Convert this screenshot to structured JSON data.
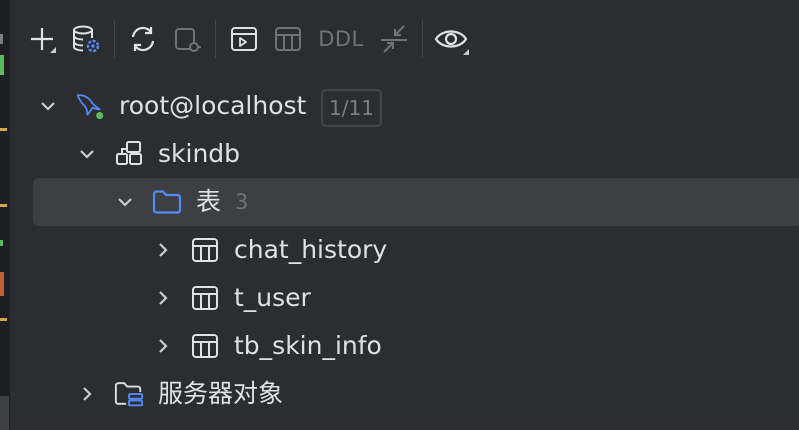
{
  "toolbar": {
    "ddl_label": "DDL",
    "buttons": [
      {
        "icon": "plus-icon"
      },
      {
        "icon": "datasource-properties-icon"
      },
      {
        "icon": "refresh-icon"
      },
      {
        "icon": "disconnect-icon"
      },
      {
        "icon": "query-console-icon"
      },
      {
        "icon": "table-view-icon"
      },
      {
        "icon": "ddl-text"
      },
      {
        "icon": "jump-to-source-icon"
      },
      {
        "icon": "view-options-icon"
      }
    ]
  },
  "tree": {
    "connection": {
      "label": "root@localhost",
      "badge": "1/11",
      "icon": "mysql-dolphin-icon"
    },
    "schema": {
      "label": "skindb",
      "icon": "schema-icon"
    },
    "tables_folder": {
      "label": "表",
      "count": "3",
      "icon": "folder-icon"
    },
    "tables": [
      {
        "label": "chat_history",
        "icon": "table-icon"
      },
      {
        "label": "t_user",
        "icon": "table-icon"
      },
      {
        "label": "tb_skin_info",
        "icon": "table-icon"
      }
    ],
    "server_objects": {
      "label": "服务器对象",
      "icon": "server-objects-icon"
    }
  },
  "colors": {
    "background": "#2b2d30",
    "selection": "#3d3f43",
    "text": "#dfe1e5",
    "muted": "#6f737a",
    "accent_blue": "#548af7",
    "status_green": "#5fb85f"
  }
}
